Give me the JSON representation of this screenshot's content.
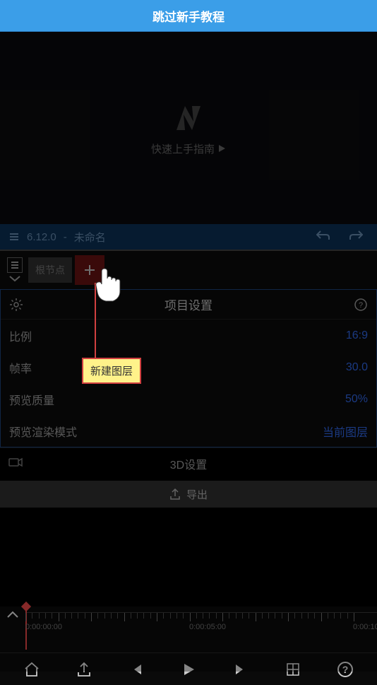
{
  "banner": {
    "skip_tutorial": "跳过新手教程"
  },
  "preview": {
    "guide_text": "快速上手指南"
  },
  "version_bar": {
    "version": "6.12.0",
    "separator": "-",
    "filename": "未命名"
  },
  "layer_bar": {
    "root_node": "根节点"
  },
  "settings": {
    "title": "项目设置",
    "rows": [
      {
        "label": "比例",
        "value": "16:9"
      },
      {
        "label": "帧率",
        "value": "30.0"
      },
      {
        "label": "预览质量",
        "value": "50%"
      },
      {
        "label": "预览渲染模式",
        "value": "当前图层"
      }
    ],
    "threed": "3D设置",
    "export": "导出"
  },
  "timeline": {
    "labels": [
      "0:00:00:00",
      "0:00:05:00",
      "0:00:10:"
    ]
  },
  "tutorial_tooltip": "新建图层"
}
